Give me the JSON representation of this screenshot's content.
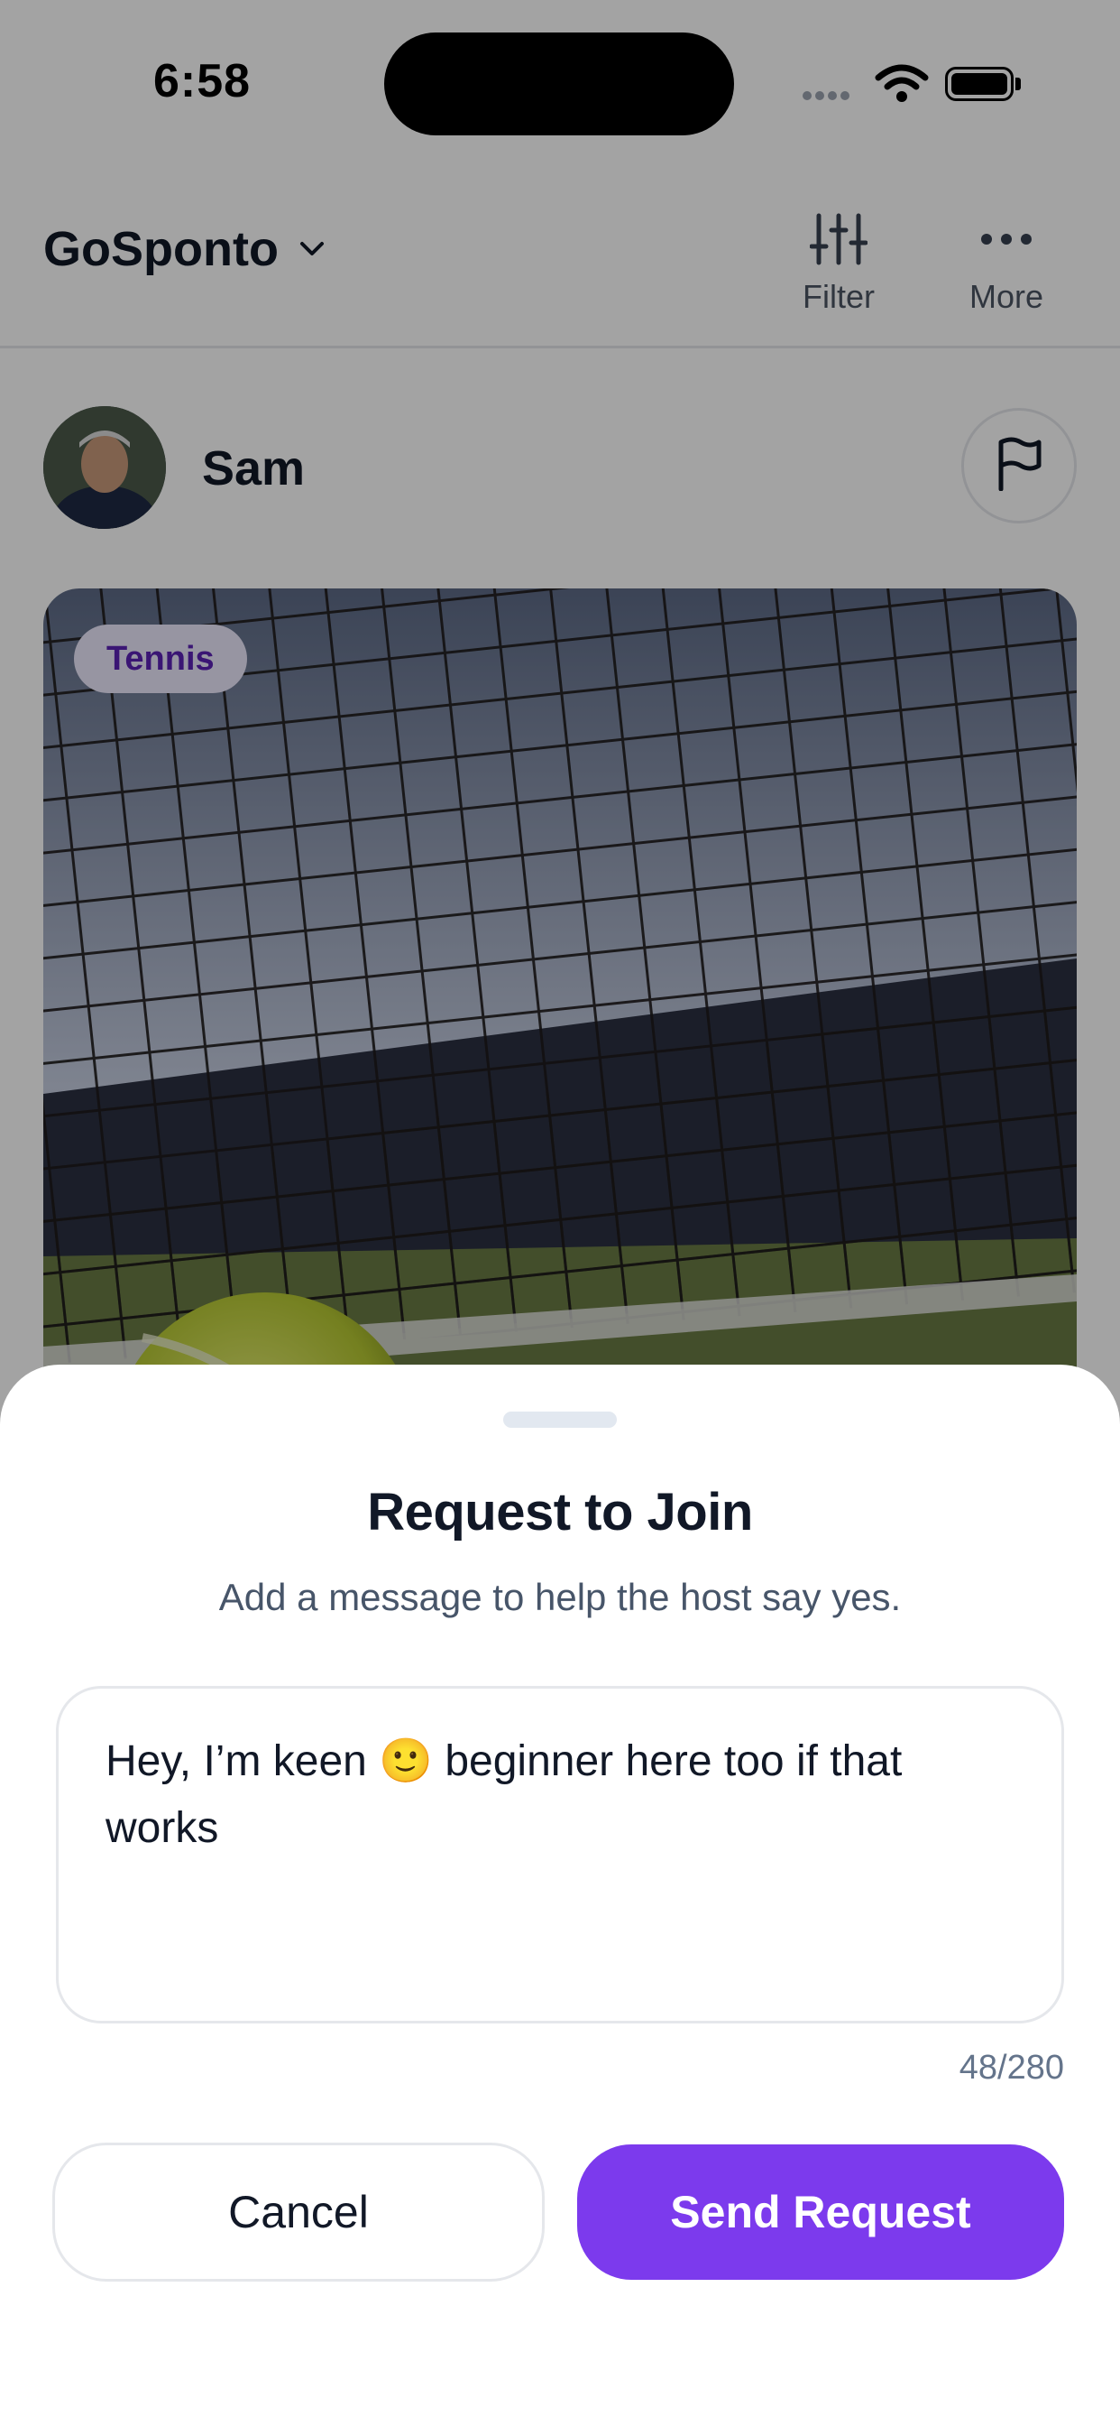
{
  "status_bar": {
    "time": "6:58"
  },
  "header": {
    "app_name": "GoSponto",
    "filter_label": "Filter",
    "more_label": "More"
  },
  "post": {
    "host_name": "Sam",
    "sport_tag": "Tennis"
  },
  "sheet": {
    "title": "Request to Join",
    "subtitle": "Add a message to help the host say yes.",
    "message": "Hey, I’m keen 🙂 beginner here too if that works",
    "char_count": "48/280",
    "cancel_label": "Cancel",
    "send_label": "Send Request"
  },
  "colors": {
    "accent": "#7c3aed",
    "tag_bg": "#ede9fe",
    "tag_text": "#5b21b6",
    "scrim": "rgba(0,0,0,0.36)"
  }
}
